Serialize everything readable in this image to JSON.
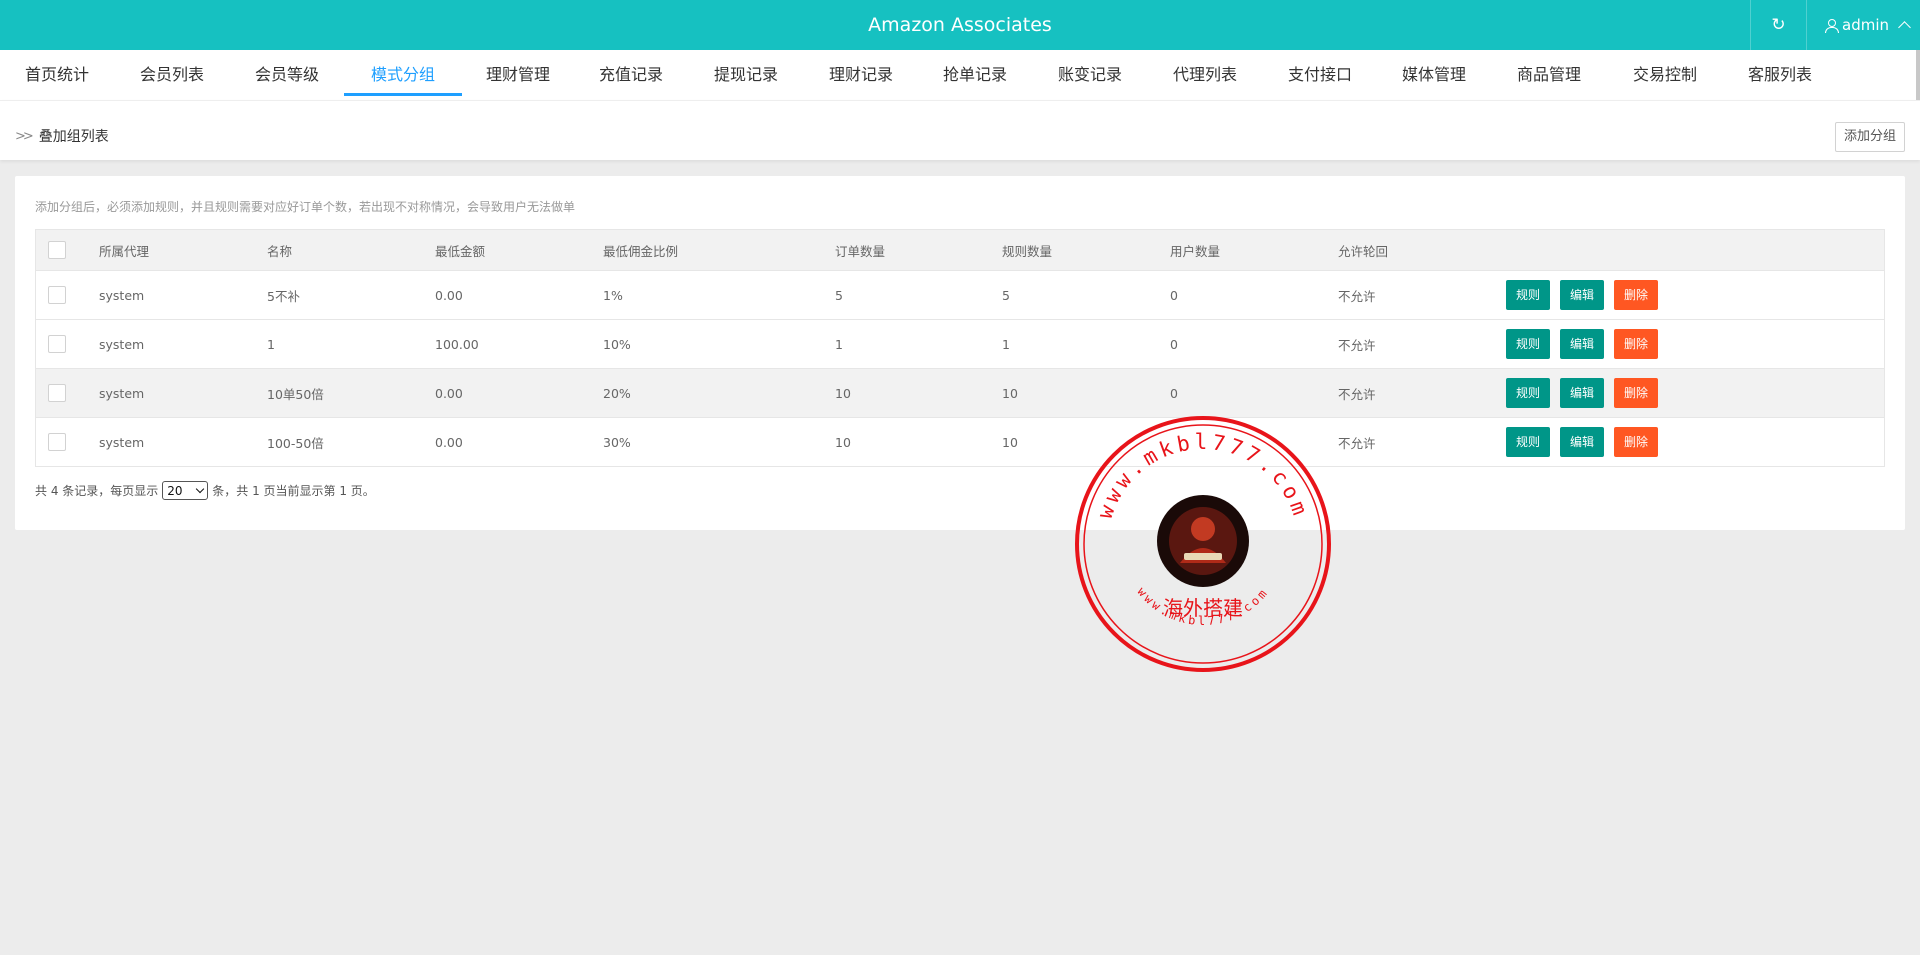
{
  "header": {
    "title": "Amazon Associates",
    "refresh_icon": "refresh-icon",
    "user_label": "admin"
  },
  "nav": {
    "tabs": [
      "首页统计",
      "会员列表",
      "会员等级",
      "模式分组",
      "理财管理",
      "充值记录",
      "提现记录",
      "理财记录",
      "抢单记录",
      "账变记录",
      "代理列表",
      "支付接口",
      "媒体管理",
      "商品管理",
      "交易控制",
      "客服列表"
    ],
    "active_index": 3
  },
  "breadcrumb": {
    "label": "叠加组列表",
    "add_button": "添加分组"
  },
  "hint": "添加分组后，必须添加规则，并且规则需要对应好订单个数，若出现不对称情况，会导致用户无法做单",
  "table": {
    "columns": [
      "所属代理",
      "名称",
      "最低金额",
      "最低佣金比例",
      "订单数量",
      "规则数量",
      "用户数量",
      "允许轮回"
    ],
    "rows": [
      {
        "agent": "system",
        "name": "5不补",
        "min_amount": "0.00",
        "min_ratio": "1%",
        "orders": "5",
        "rules": "5",
        "users": "0",
        "cycle": "不允许"
      },
      {
        "agent": "system",
        "name": "1",
        "min_amount": "100.00",
        "min_ratio": "10%",
        "orders": "1",
        "rules": "1",
        "users": "0",
        "cycle": "不允许"
      },
      {
        "agent": "system",
        "name": "10单50倍",
        "min_amount": "0.00",
        "min_ratio": "20%",
        "orders": "10",
        "rules": "10",
        "users": "0",
        "cycle": "不允许"
      },
      {
        "agent": "system",
        "name": "100-50倍",
        "min_amount": "0.00",
        "min_ratio": "30%",
        "orders": "10",
        "rules": "10",
        "users": "",
        "cycle": "不允许"
      }
    ],
    "actions": {
      "rule": "规则",
      "edit": "编辑",
      "delete": "删除"
    },
    "action_colors": {
      "rule": "#009688",
      "edit": "#009688",
      "delete": "#ff5722"
    }
  },
  "pager": {
    "prefix": "共 4 条记录，每页显示",
    "page_size": "20",
    "suffix": "条，共 1 页当前显示第 1 页。"
  },
  "watermark": {
    "top_text": "www.mkbl777.com",
    "center_text": "海外搭建",
    "bottom_text": "www.mkbl777.com",
    "color": "#e8141a"
  }
}
